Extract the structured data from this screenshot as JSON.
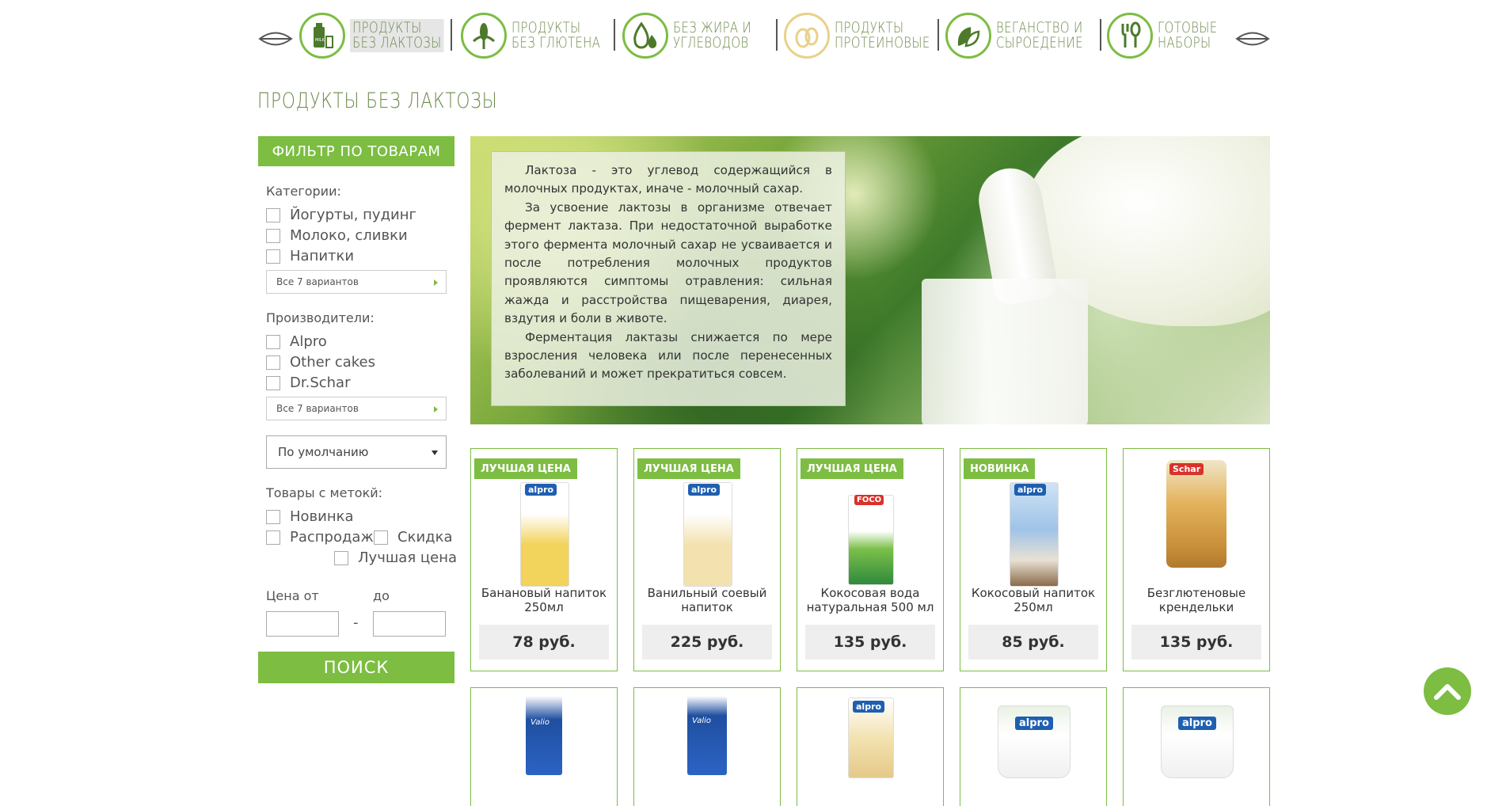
{
  "nav": {
    "categories": [
      {
        "line1": "Продукты",
        "line2": "без лактозы",
        "icon": "milk-bottle-icon"
      },
      {
        "line1": "Продукты",
        "line2": "без глютена",
        "icon": "wheat-icon"
      },
      {
        "line1": "Без жира и",
        "line2": "углеводов",
        "icon": "drops-icon"
      },
      {
        "line1": "Продукты",
        "line2": "протеиновые",
        "icon": "eggs-icon"
      },
      {
        "line1": "Веганство и",
        "line2": "сыроедение",
        "icon": "leaves-icon"
      },
      {
        "line1": "Готовые",
        "line2": "наборы",
        "icon": "fork-spoon-icon"
      }
    ]
  },
  "page_title": "Продукты без лактозы",
  "sidebar": {
    "filter_title": "ФИЛЬТР ПО ТОВАРАМ",
    "categories_label": "Категории:",
    "categories": [
      "Йогурты, пудинг",
      "Молоко, сливки",
      "Напитки"
    ],
    "categories_more": "Все 7 вариантов",
    "makers_label": "Производители:",
    "makers": [
      "Alpro",
      "Other cakes",
      "Dr.Schar"
    ],
    "makers_more": "Все 7 вариантов",
    "sort_value": "По умолчанию",
    "tags_label": "Товары с метокй:",
    "tags": [
      "Новинка",
      "Распродажа",
      "Скидка",
      "Лучшая цена"
    ],
    "price_from": "Цена от",
    "price_to": "до",
    "price_dash": "-",
    "search_button": "ПОИСК"
  },
  "banner": {
    "paragraphs": [
      "Лактоза - это углевод содержащийся в молочных продуктах, иначе - молочный сахар.",
      "За усвоение лактозы в организме отвечает фермент лактаза. При недостаточной выработке этого фермента молочный сахар не усваивается и после потребления молочных продуктов проявляются симптомы отравления: сильная жажда и расстройства пищеварения, диарея, вздутия и боли в животе.",
      "Ферментация лактазы снижается по мере взросления человека или после перенесенных заболеваний и может прекратиться совсем."
    ]
  },
  "products": [
    {
      "badge": "ЛУЧШАЯ ЦЕНА",
      "name": "Банановый напиток 250мл",
      "price": "78 руб.",
      "brand": "alpro",
      "color": "#f2d35b"
    },
    {
      "badge": "ЛУЧШАЯ ЦЕНА",
      "name": "Ванильный соевый напиток",
      "price": "225 руб.",
      "brand": "alpro",
      "color": "#f3e2b0"
    },
    {
      "badge": "ЛУЧШАЯ ЦЕНА",
      "name": "Кокосовая вода натуральная 500 мл",
      "price": "135 руб.",
      "brand": "FOCO",
      "color": "#7cc04a"
    },
    {
      "badge": "НОВИНКА",
      "name": "Кокосовый напиток 250мл",
      "price": "85 руб.",
      "brand": "alpro",
      "color": "#9fc3e8"
    },
    {
      "badge": "",
      "name": "Безглютеновые крендельки",
      "price": "135 руб.",
      "brand": "Schar",
      "color": "#e3b35c"
    }
  ],
  "products_row2": [
    {
      "brand": "Valio",
      "color": "#1f4fa0"
    },
    {
      "brand": "Valio",
      "color": "#1f4fa0"
    },
    {
      "brand": "alpro",
      "color": "#f3e2b0"
    },
    {
      "brand": "alpro",
      "color": "#eaeaea"
    },
    {
      "brand": "alpro",
      "color": "#eaeaea"
    }
  ]
}
